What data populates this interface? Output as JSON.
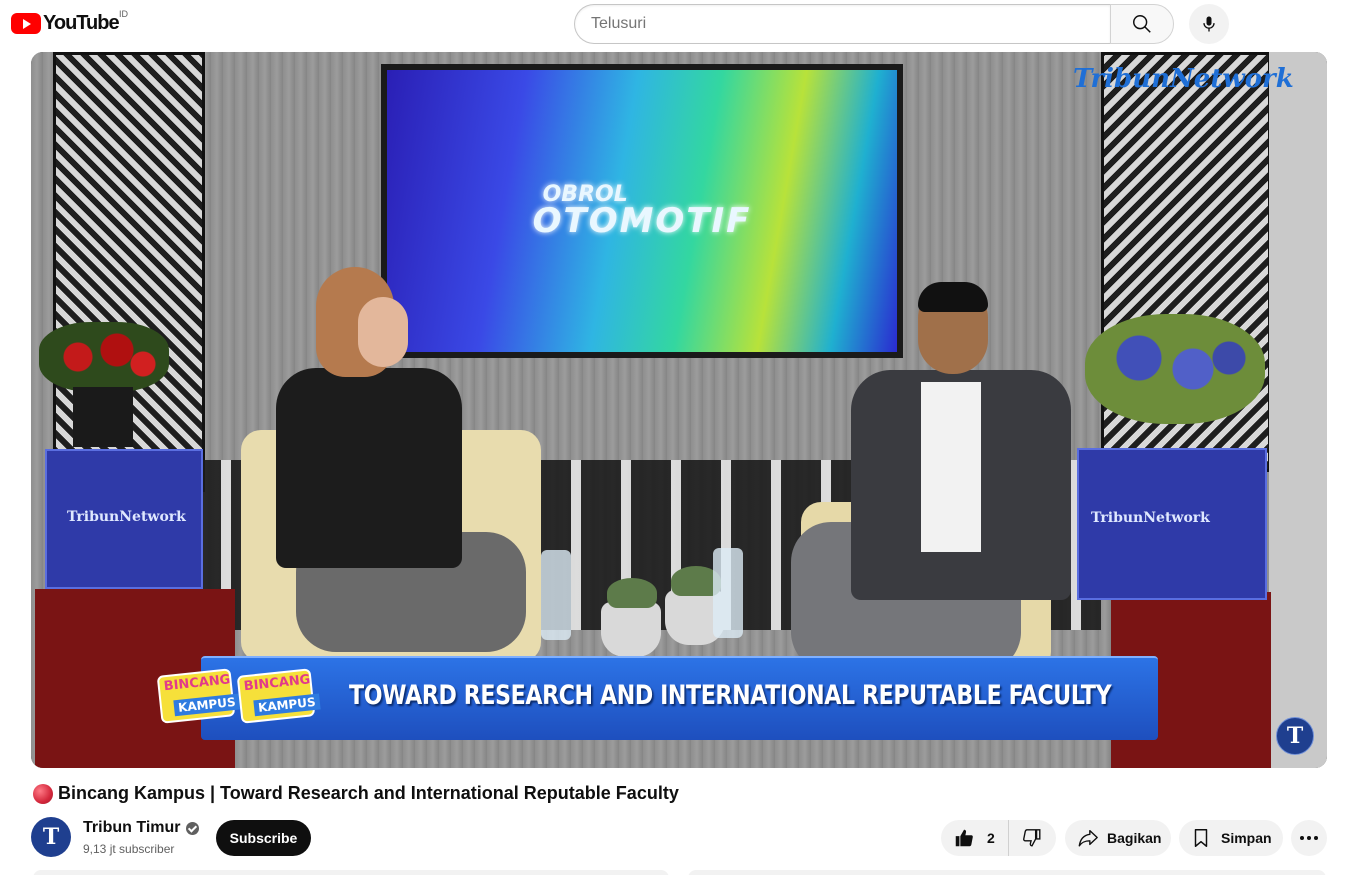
{
  "header": {
    "logo_text": "YouTube",
    "country_code": "ID",
    "search_placeholder": "Telusuri",
    "icons": [
      "search-icon",
      "mic-icon"
    ]
  },
  "video": {
    "tv_title_line1": "OBROL",
    "tv_title_line2": "OTOMOTIF",
    "corner_brand": "TribunNetwork",
    "box_label": "TribunNetwork",
    "lower_third_text": "TOWARD RESEARCH AND INTERNATIONAL REPUTABLE FACULTY",
    "program_badge_line1": "BINCANG",
    "program_badge_line2": "KAMPUS",
    "watermark": "T"
  },
  "meta": {
    "title": "Bincang Kampus | Toward Research and International Reputable Faculty",
    "channel_name": "Tribun Timur",
    "channel_avatar_letter": "T",
    "subscribers": "9,13 jt subscriber",
    "subscribe_label": "Subscribe"
  },
  "actions": {
    "like_count": "2",
    "share_label": "Bagikan",
    "save_label": "Simpan",
    "icons": [
      "like-icon",
      "dislike-icon",
      "share-icon",
      "save-icon",
      "more-icon"
    ]
  }
}
